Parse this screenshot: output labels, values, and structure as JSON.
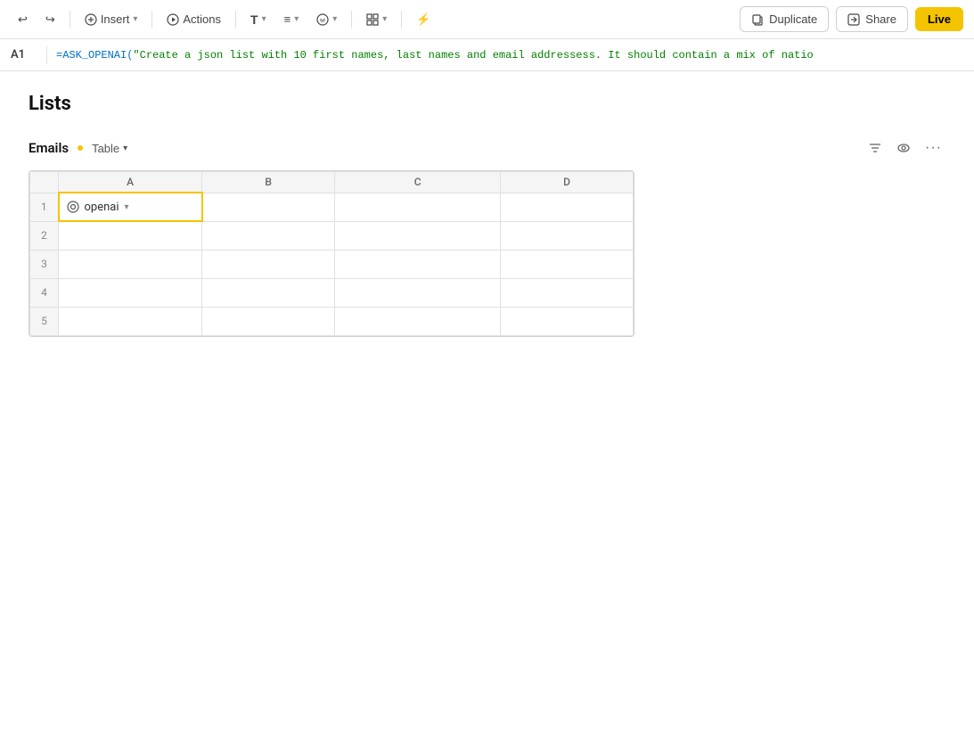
{
  "toolbar": {
    "undo_icon": "↩",
    "redo_icon": "↪",
    "insert_label": "Insert",
    "actions_label": "Actions",
    "text_icon": "T",
    "align_icon": "≡",
    "palette_icon": "◑",
    "layout_icon": "⊞",
    "lightning_icon": "⚡",
    "duplicate_label": "Duplicate",
    "share_label": "Share",
    "live_label": "Live"
  },
  "formula_bar": {
    "cell_ref": "A1",
    "formula": "=ASK_OPENAI(\"Create a json list with 10 first names, last names and email addressess. It should contain a mix of natio"
  },
  "page": {
    "title": "Lists"
  },
  "table": {
    "name": "Emails",
    "view": "Table",
    "columns": [
      "A",
      "B",
      "C",
      "D"
    ],
    "rows": [
      {
        "num": "1",
        "a_content": "openai",
        "b": "",
        "c": "",
        "d": ""
      },
      {
        "num": "2",
        "a": "",
        "b": "",
        "c": "",
        "d": ""
      },
      {
        "num": "3",
        "a": "",
        "b": "",
        "c": "",
        "d": ""
      },
      {
        "num": "4",
        "a": "",
        "b": "",
        "c": "",
        "d": ""
      },
      {
        "num": "5",
        "a": "",
        "b": "",
        "c": "",
        "d": ""
      }
    ]
  }
}
